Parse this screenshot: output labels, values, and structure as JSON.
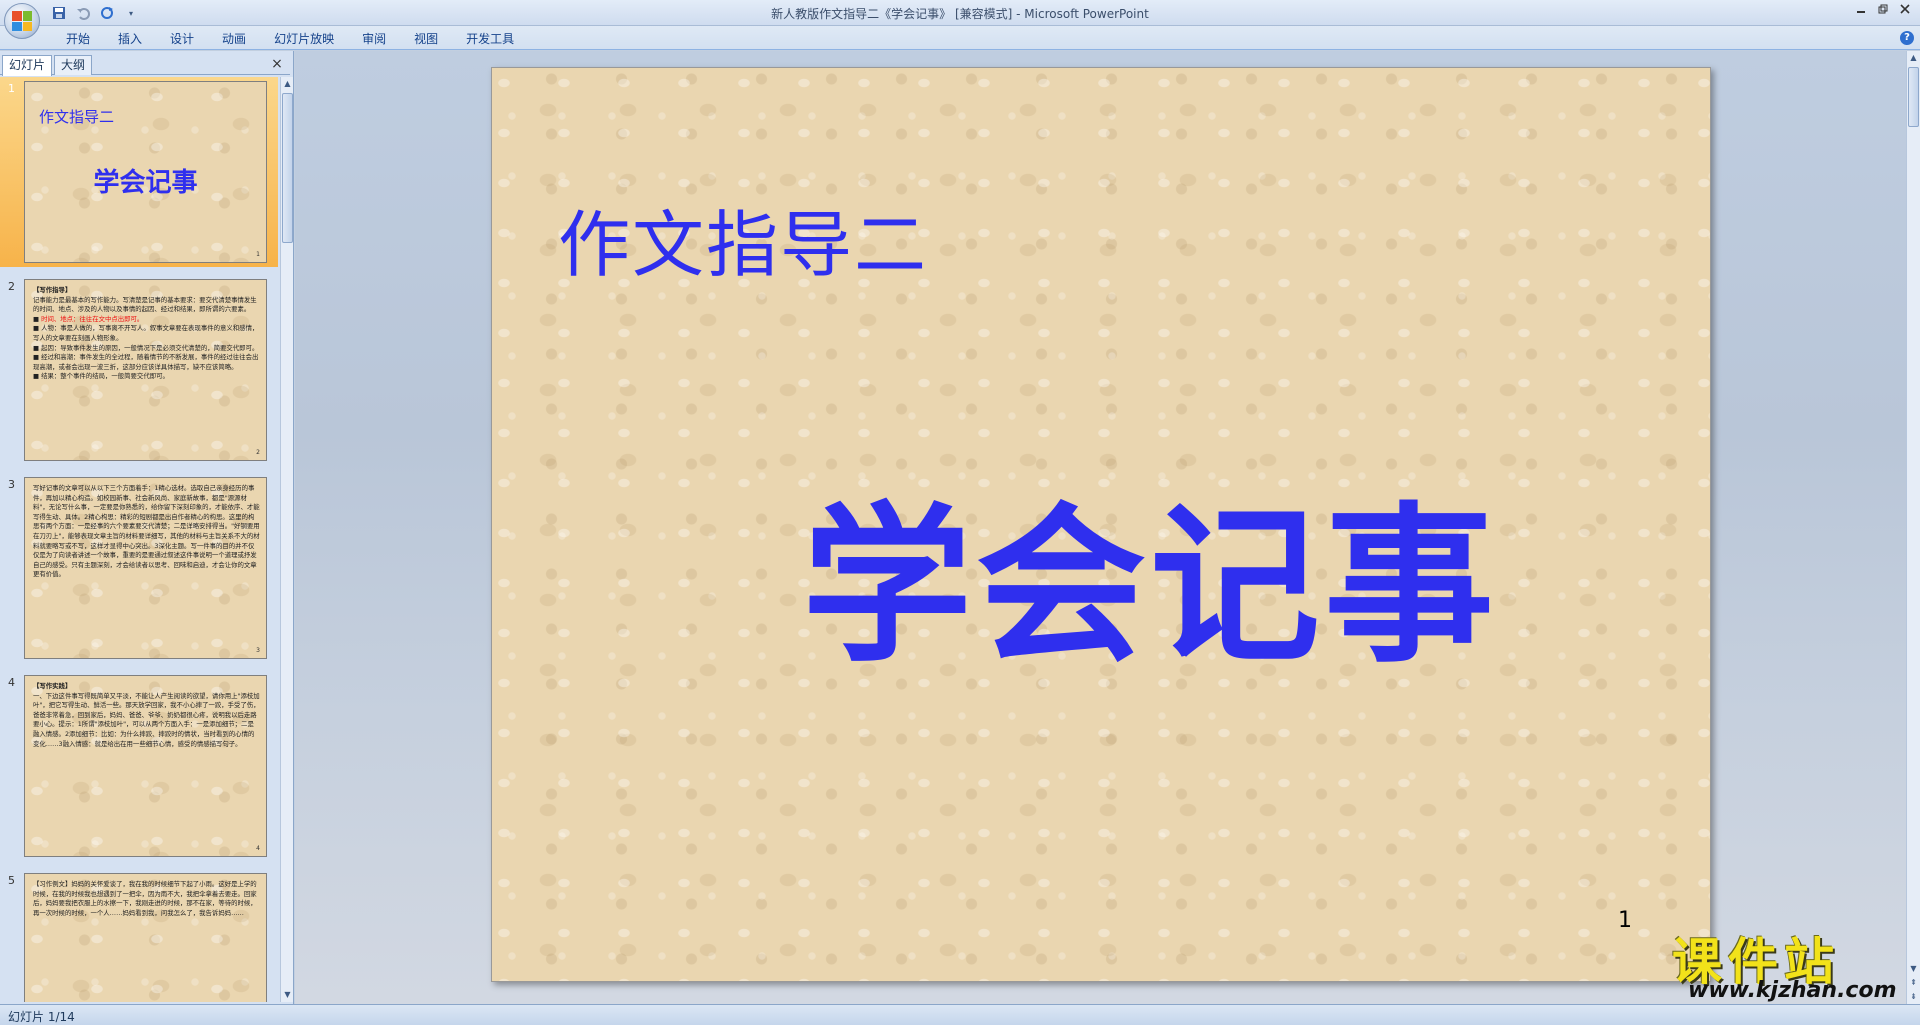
{
  "window": {
    "title": "新人教版作文指导二《学会记事》 [兼容模式] - Microsoft PowerPoint"
  },
  "quick_access": {
    "save_icon": "save-icon",
    "undo_icon": "undo-icon",
    "redo_icon": "redo-icon",
    "customize_icon": "chevron-down-icon"
  },
  "ribbon": {
    "tabs": [
      {
        "label": "开始"
      },
      {
        "label": "插入"
      },
      {
        "label": "设计"
      },
      {
        "label": "动画"
      },
      {
        "label": "幻灯片放映"
      },
      {
        "label": "审阅"
      },
      {
        "label": "视图"
      },
      {
        "label": "开发工具"
      }
    ],
    "help": "?"
  },
  "left_panel": {
    "tab_slides": "幻灯片",
    "tab_outline": "大纲",
    "close": "×",
    "thumbnails": [
      {
        "num": "1",
        "subtitle": "作文指导二",
        "title": "学会记事",
        "page": "1"
      },
      {
        "num": "2",
        "page": "2",
        "heading": "【写作指导】",
        "lines": [
          "记事能力是最基本的写作能力。写清楚是记事的基本要求：要交代清楚事情发生的时间、地点、涉及的人物以及事情的起因、经过和结果，即所谓的六要素。",
          "时间、地点：往往在文中点出即可。",
          "人物：事是人做的，写事离不开写人。叙事文章要在表现事件的意义和感情，写人的文章要在刻画人物形象。",
          "起因：导致事件发生的原因，一般情况下是必须交代清楚的，简要交代即可。",
          "经过和高潮：事件发生的全过程，随着情节的不断发展，事件的经过往往会出现高潮，或者会出现一波三折，这部分应该详具体描写，缺不应该简略。",
          "结果：整个事件的结局，一般简要交代即可。"
        ]
      },
      {
        "num": "3",
        "page": "3",
        "text": "写好记事的文章可以从以下三个方面着手：1精心选材。选取自己亲身经历的事件，再加以精心构造。如校园新事、社会新风尚、家庭新故事，都是\"源源材料\"，无论写什么事，一定要是你熟悉的，给你留下深刻印象的，才能依序、才能写得生动、具体。2精心构思：精彩的短剧都是出自作者精心的构思。这里的构思有两个方面：一是经事的六个要素要交代清楚；二是详略安排得当。\"好钢要用在刀刃上\"，能够表现文章主旨的材料要详细写，其他的材料与主旨关系不大的材料就要略写或不写，这样才显得中心突出。3深化主题。写一件事的目的并不仅仅是为了向读者讲述一个故事，重要的是要通过叙述这件事说明一个道理或抒发自己的感受。只有主题深刻，才会给读者以思考、回味和启迪，才会让你的文章更有价值。"
      },
      {
        "num": "4",
        "page": "4",
        "heading": "【写作实践】",
        "text": "一、下边这件事写得既简单又平淡，不能让人产生阅读的欲望，请你用上\"添枝加叶\"，把它写得生动、鲜活一些。那天放学回家，我不小心摔了一跤，手受了伤，爸爸非常着急，回到家后，妈妈、爸爸、爷爷、奶奶都很心疼，说明我以后走路要小心。提示：1所谓\"添枝加叶\"，可以从两个方面入手：一是添加细节；二是融入情感。2添加细节：比如：为什么摔跤、摔跤时的情状，当时看到的心情的变化……3融入情感：就是给出在用一些细节心情，感受的情感描写句子。"
      },
      {
        "num": "5",
        "page": "5",
        "text": "【习作例文】妈妈的关怀爱谈了，我在我的时候细节下起了小雨。这好是上学的时候，在我的时候我也想遇到了一把伞，因为雨不大，我把伞拿着去要走。回家后，妈妈要我把衣服上的水擦一下，我刚走进的时候，那不在家，等待的时候，再一次时候的时候，一个人……妈妈看到我，问我怎么了，我告诉妈妈……"
      }
    ]
  },
  "slide": {
    "subtitle": "作文指导二",
    "title": "学会记事",
    "number": "1"
  },
  "status": {
    "slide_indicator": "幻灯片 1/14"
  },
  "watermark": {
    "brand": "课件站",
    "url": "www.kjzhan.com"
  },
  "colors": {
    "slide_text": "#2f2fee",
    "selected_thumb": "#f7b34a",
    "highlight_red": "#e11111"
  }
}
